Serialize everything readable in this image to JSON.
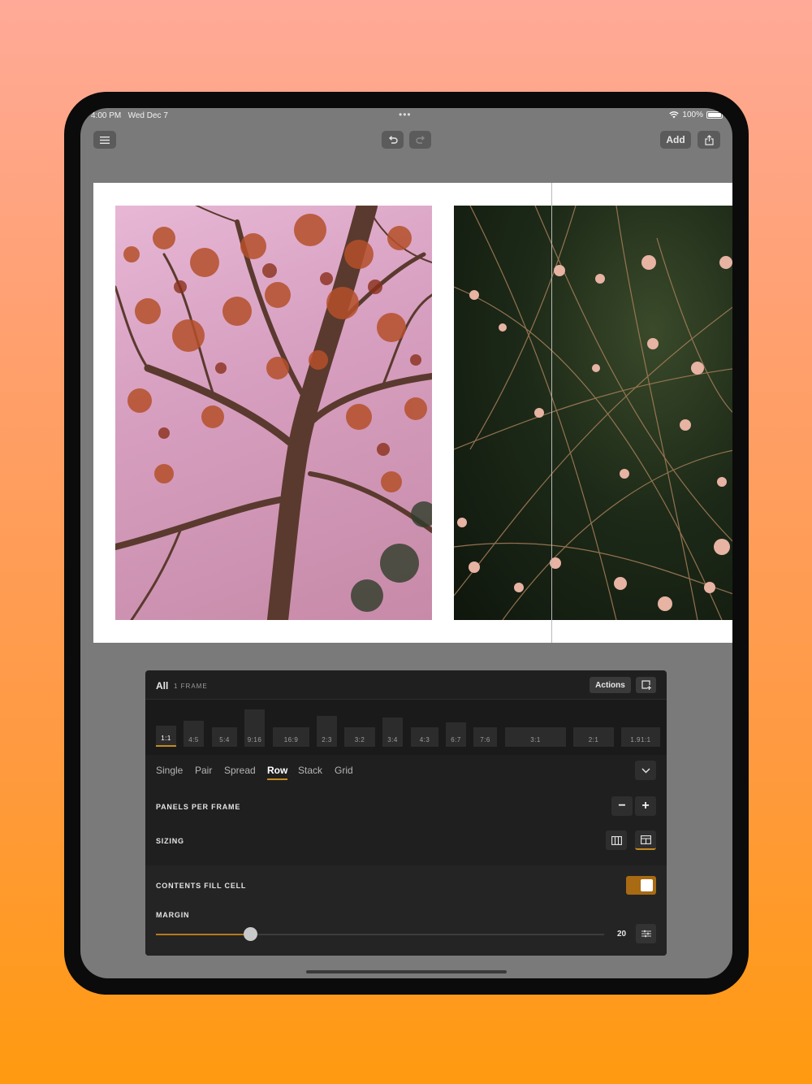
{
  "status": {
    "time": "4:00 PM",
    "date": "Wed Dec 7",
    "battery": "100%"
  },
  "toolbar": {
    "menu_icon": "hamburger-icon",
    "undo_icon": "undo-icon",
    "redo_icon": "redo-icon",
    "add_label": "Add",
    "share_icon": "share-icon"
  },
  "panel": {
    "title": "All",
    "subtitle": "1 FRAME",
    "actions_label": "Actions",
    "ratios": [
      {
        "label": "1:1",
        "active": true
      },
      {
        "label": "4:5"
      },
      {
        "label": "5:4"
      },
      {
        "label": "9:16"
      },
      {
        "label": "16:9"
      },
      {
        "label": "2:3"
      },
      {
        "label": "3:2"
      },
      {
        "label": "3:4"
      },
      {
        "label": "4:3"
      },
      {
        "label": "6:7"
      },
      {
        "label": "7:6"
      },
      {
        "label": "3:1"
      },
      {
        "label": "2:1"
      },
      {
        "label": "1.91:1"
      }
    ],
    "layouts": [
      "Single",
      "Pair",
      "Spread",
      "Row",
      "Stack",
      "Grid"
    ],
    "active_layout": "Row",
    "panels_per_frame_label": "PANELS PER FRAME",
    "minus": "−",
    "plus": "+",
    "sizing_label": "SIZING",
    "contents_fill_label": "CONTENTS FILL CELL",
    "contents_fill_on": true,
    "margin_label": "MARGIN",
    "margin_value": "20",
    "margin_fraction": 0.21
  },
  "colors": {
    "accent": "#c58a1f",
    "panel_bg": "#1f1f1f",
    "toggle": "#a86a12"
  }
}
